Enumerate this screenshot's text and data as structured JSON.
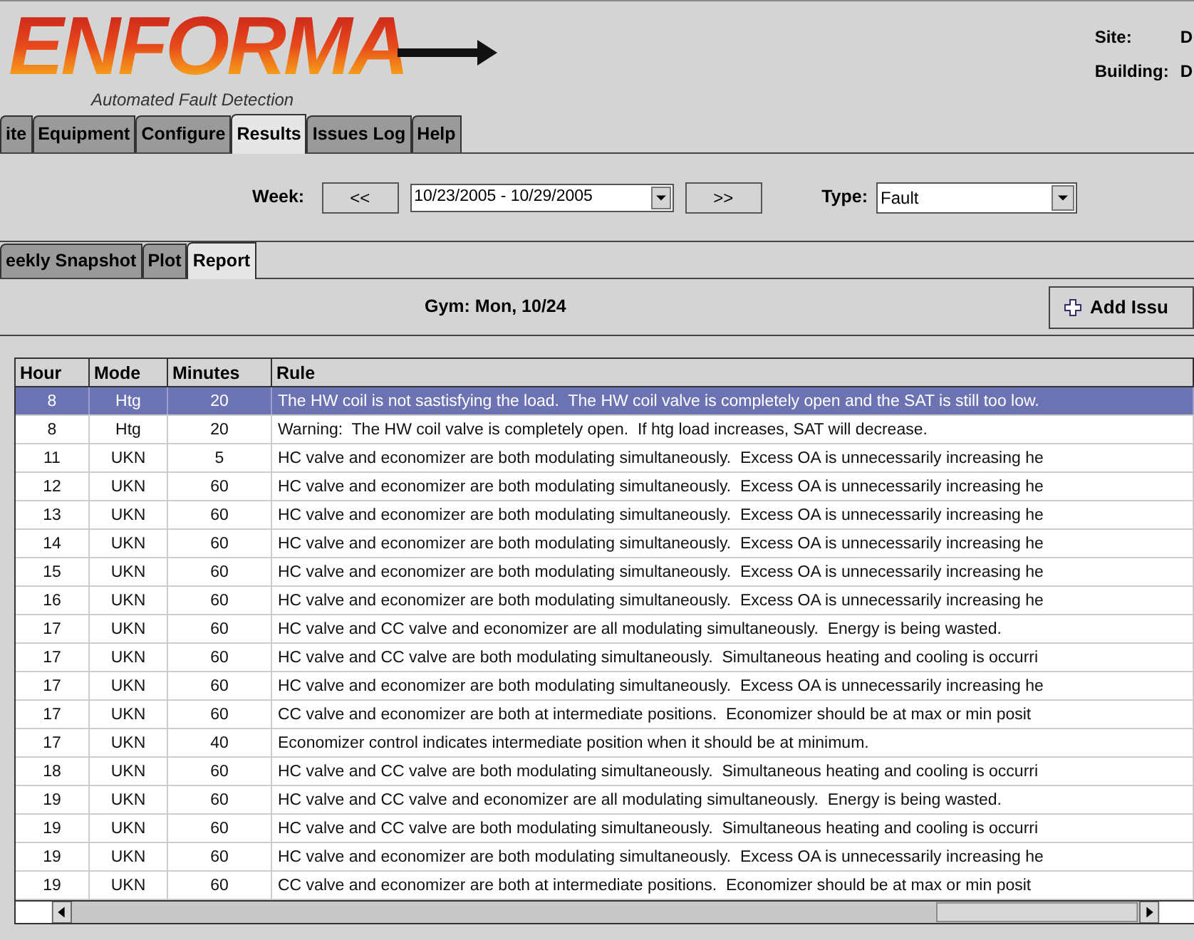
{
  "header": {
    "logo": "ENFORMA",
    "tagline": "Automated Fault Detection",
    "info": [
      {
        "label": "Site:",
        "value": "D"
      },
      {
        "label": "Building:",
        "value": "D"
      }
    ]
  },
  "tabs": [
    {
      "label": "ite",
      "selected": false
    },
    {
      "label": "Equipment",
      "selected": false
    },
    {
      "label": "Configure",
      "selected": false
    },
    {
      "label": "Results",
      "selected": true
    },
    {
      "label": "Issues Log",
      "selected": false
    },
    {
      "label": "Help",
      "selected": false
    }
  ],
  "toolbar": {
    "week_label": "Week:",
    "prev": "<<",
    "week": "10/23/2005 - 10/29/2005",
    "next": ">>",
    "type_label": "Type:",
    "type": "Fault"
  },
  "subtabs": [
    {
      "label": "eekly Snapshot",
      "selected": false
    },
    {
      "label": "Plot",
      "selected": false
    },
    {
      "label": "Report",
      "selected": true
    }
  ],
  "report": {
    "title": "Gym: Mon, 10/24",
    "add_button": "Add Issu"
  },
  "table": {
    "columns": [
      "Hour",
      "Mode",
      "Minutes",
      "Rule"
    ],
    "rows": [
      {
        "cells": [
          "8",
          "Htg",
          "20",
          "The HW coil is not sastisfying the load.  The HW coil valve is completely open and the SAT is still too low."
        ],
        "selected": true
      },
      {
        "cells": [
          "8",
          "Htg",
          "20",
          "Warning:  The HW coil valve is completely open.  If htg load increases, SAT will decrease."
        ],
        "selected": false
      },
      {
        "cells": [
          "11",
          "UKN",
          "5",
          "HC valve and economizer are both modulating simultaneously.  Excess OA is unnecessarily increasing he"
        ],
        "selected": false
      },
      {
        "cells": [
          "12",
          "UKN",
          "60",
          "HC valve and economizer are both modulating simultaneously.  Excess OA is unnecessarily increasing he"
        ],
        "selected": false
      },
      {
        "cells": [
          "13",
          "UKN",
          "60",
          "HC valve and economizer are both modulating simultaneously.  Excess OA is unnecessarily increasing he"
        ],
        "selected": false
      },
      {
        "cells": [
          "14",
          "UKN",
          "60",
          "HC valve and economizer are both modulating simultaneously.  Excess OA is unnecessarily increasing he"
        ],
        "selected": false
      },
      {
        "cells": [
          "15",
          "UKN",
          "60",
          "HC valve and economizer are both modulating simultaneously.  Excess OA is unnecessarily increasing he"
        ],
        "selected": false
      },
      {
        "cells": [
          "16",
          "UKN",
          "60",
          "HC valve and economizer are both modulating simultaneously.  Excess OA is unnecessarily increasing he"
        ],
        "selected": false
      },
      {
        "cells": [
          "17",
          "UKN",
          "60",
          "HC valve and CC valve and economizer are all modulating simultaneously.  Energy is being wasted."
        ],
        "selected": false
      },
      {
        "cells": [
          "17",
          "UKN",
          "60",
          "HC valve and CC valve are both modulating simultaneously.  Simultaneous heating and cooling is occurri"
        ],
        "selected": false
      },
      {
        "cells": [
          "17",
          "UKN",
          "60",
          "HC valve and economizer are both modulating simultaneously.  Excess OA is unnecessarily increasing he"
        ],
        "selected": false
      },
      {
        "cells": [
          "17",
          "UKN",
          "60",
          "CC valve and economizer are both at intermediate positions.  Economizer should be at max or min posit"
        ],
        "selected": false
      },
      {
        "cells": [
          "17",
          "UKN",
          "40",
          "Economizer control indicates intermediate position when it should be at minimum."
        ],
        "selected": false
      },
      {
        "cells": [
          "18",
          "UKN",
          "60",
          "HC valve and CC valve are both modulating simultaneously.  Simultaneous heating and cooling is occurri"
        ],
        "selected": false
      },
      {
        "cells": [
          "19",
          "UKN",
          "60",
          "HC valve and CC valve and economizer are all modulating simultaneously.  Energy is being wasted."
        ],
        "selected": false
      },
      {
        "cells": [
          "19",
          "UKN",
          "60",
          "HC valve and CC valve are both modulating simultaneously.  Simultaneous heating and cooling is occurri"
        ],
        "selected": false
      },
      {
        "cells": [
          "19",
          "UKN",
          "60",
          "HC valve and economizer are both modulating simultaneously.  Excess OA is unnecessarily increasing he"
        ],
        "selected": false
      },
      {
        "cells": [
          "19",
          "UKN",
          "60",
          "CC valve and economizer are both at intermediate positions.  Economizer should be at max or min posit"
        ],
        "selected": false
      }
    ]
  }
}
